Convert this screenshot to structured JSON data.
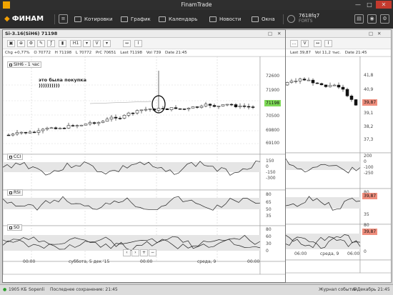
{
  "window": {
    "title": "FinamTrade",
    "min": "—",
    "max": "□",
    "close": "✕"
  },
  "toolbar": {
    "logo": "ФИНАМ",
    "buttons": [
      "Котировки",
      "График",
      "Календарь",
      "Новости",
      "Окна"
    ],
    "account_id": "7618fq7",
    "account_sub": "FORTS"
  },
  "main_chart": {
    "header": "Si-3.16(SiH6) 71198",
    "tools": [
      "H1",
      "V"
    ],
    "info": {
      "chg": "Chg +0,77%",
      "o": "O 70772",
      "h": "H 71198",
      "l": "L 70772",
      "prc": "PrC 70651",
      "last": "Last 71198",
      "vol": "Vol 739",
      "date": "Date 21:45"
    },
    "series_label": "SIH6 - 1 час",
    "annotation": "это была покупка\n))))))))))",
    "y_ticks": [
      "72600",
      "71900",
      "71198",
      "70500",
      "69800",
      "69100"
    ],
    "last_price": "71198",
    "cci_label": "CCI",
    "cci_ticks": [
      "150",
      "0",
      "-150",
      "-300"
    ],
    "rsi_label": "RSI",
    "rsi_ticks": [
      "80",
      "65",
      "50",
      "35"
    ],
    "so_label": "SO",
    "so_ticks": [
      "80",
      "60",
      "30",
      "0"
    ],
    "x_ticks": [
      "00:00",
      "суббота, 5 дек '15",
      "00:00",
      "среда, 9",
      "00:00"
    ],
    "colors": {
      "up": "#ffffff",
      "down": "#111111",
      "price_tag": "#7ed957"
    }
  },
  "side_chart": {
    "info": {
      "last": "Last 39,87",
      "vol": "Vol 11,2 тыс.",
      "date": "Date 21:45"
    },
    "y_ticks": [
      "41,8",
      "40,9",
      "39,87",
      "39,1",
      "38,2",
      "37,3"
    ],
    "last_price": "39,87",
    "cci_ticks": [
      "200",
      "0",
      "-100",
      "-250"
    ],
    "rsi_ticks": [
      "80",
      "39,87",
      "35"
    ],
    "so_ticks": [
      "80",
      "39,87",
      "0"
    ],
    "x_ticks": [
      "06:00",
      "среда, 9",
      "06:00"
    ],
    "colors": {
      "price_tag": "#f08f7e"
    }
  },
  "status": {
    "size": "1905 КБ",
    "app": "Sopenli",
    "saved": "Последнее сохранение: 21:45",
    "journal": "Журнал событий",
    "datetime": "9 Декабрь 21:45"
  }
}
